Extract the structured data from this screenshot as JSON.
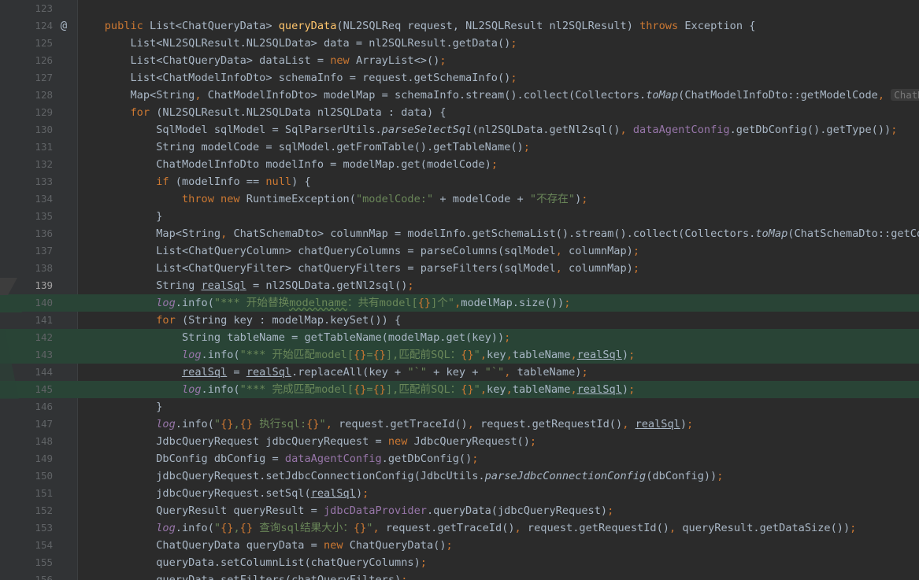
{
  "editor": {
    "language": "java",
    "current_line": "139",
    "colors": {
      "background": "#2b2b2b",
      "gutter": "#313335",
      "keyword": "#cc7832",
      "method": "#ffc66d",
      "string": "#6a8759",
      "field": "#9876aa",
      "diff_added": "#294436"
    },
    "gutter_icons": {
      "124": "override-at-icon"
    },
    "lines": [
      {
        "n": "123",
        "d": false,
        "t": []
      },
      {
        "n": "124",
        "d": false,
        "t": [
          [
            "    ",
            ""
          ],
          [
            "public ",
            "kw"
          ],
          [
            "List<ChatQueryData> ",
            ""
          ],
          [
            "queryData",
            "fn"
          ],
          [
            "(NL2SQLReq request, NL2SQLResult nl2SQLResult) ",
            ""
          ],
          [
            "throws ",
            "kw"
          ],
          [
            "Exception {",
            ""
          ]
        ]
      },
      {
        "n": "125",
        "d": false,
        "t": [
          [
            "        List<NL2SQLResult.NL2SQLData> data = nl2SQLResult.getData()",
            ""
          ],
          [
            ";",
            "kw"
          ]
        ]
      },
      {
        "n": "126",
        "d": false,
        "t": [
          [
            "        List<ChatQueryData> dataList = ",
            ""
          ],
          [
            "new ",
            "kw"
          ],
          [
            "ArrayList<>()",
            ""
          ],
          [
            ";",
            "kw"
          ]
        ]
      },
      {
        "n": "127",
        "d": false,
        "t": [
          [
            "        List<ChatModelInfoDto> schemaInfo = request.getSchemaInfo()",
            ""
          ],
          [
            ";",
            "kw"
          ]
        ]
      },
      {
        "n": "128",
        "d": false,
        "t": [
          [
            "        Map<String",
            ""
          ],
          [
            ", ",
            "kw"
          ],
          [
            "ChatModelInfoDto> modelMap = schemaInfo.stream().collect(Collectors.",
            ""
          ],
          [
            "toMap",
            "it"
          ],
          [
            "(ChatModelInfoDto::getModelCode",
            ""
          ],
          [
            ", ",
            "kw"
          ],
          [
            "ChatModelInfoDto",
            "hint"
          ]
        ]
      },
      {
        "n": "129",
        "d": false,
        "t": [
          [
            "        ",
            ""
          ],
          [
            "for ",
            "kw"
          ],
          [
            "(NL2SQLResult.NL2SQLData nl2SQLData : data) {",
            ""
          ]
        ]
      },
      {
        "n": "130",
        "d": false,
        "t": [
          [
            "            SqlModel sqlModel = SqlParserUtils.",
            ""
          ],
          [
            "parseSelectSql",
            "it"
          ],
          [
            "(nl2SQLData.getNl2sql()",
            ""
          ],
          [
            ", ",
            "kw"
          ],
          [
            "dataAgentConfig",
            "fd"
          ],
          [
            ".getDbConfig().getType())",
            ""
          ],
          [
            ";",
            "kw"
          ]
        ]
      },
      {
        "n": "131",
        "d": false,
        "t": [
          [
            "            String modelCode = sqlModel.getFromTable().getTableName()",
            ""
          ],
          [
            ";",
            "kw"
          ]
        ]
      },
      {
        "n": "132",
        "d": false,
        "t": [
          [
            "            ChatModelInfoDto modelInfo = modelMap.get(modelCode)",
            ""
          ],
          [
            ";",
            "kw"
          ]
        ]
      },
      {
        "n": "133",
        "d": false,
        "t": [
          [
            "            ",
            ""
          ],
          [
            "if ",
            "kw"
          ],
          [
            "(modelInfo == ",
            ""
          ],
          [
            "null",
            "kw"
          ],
          [
            ") {",
            ""
          ]
        ]
      },
      {
        "n": "134",
        "d": false,
        "t": [
          [
            "                ",
            ""
          ],
          [
            "throw new ",
            "kw"
          ],
          [
            "RuntimeException(",
            ""
          ],
          [
            "\"modelCode:\"",
            "st"
          ],
          [
            " + modelCode + ",
            ""
          ],
          [
            "\"不存在\"",
            "st"
          ],
          [
            ")",
            ""
          ],
          [
            ";",
            "kw"
          ]
        ]
      },
      {
        "n": "135",
        "d": false,
        "t": [
          [
            "            }",
            ""
          ]
        ]
      },
      {
        "n": "136",
        "d": false,
        "t": [
          [
            "            Map<String",
            ""
          ],
          [
            ", ",
            "kw"
          ],
          [
            "ChatSchemaDto> columnMap = modelInfo.getSchemaList().stream().collect(Collectors.",
            ""
          ],
          [
            "toMap",
            "it"
          ],
          [
            "(ChatSchemaDto::getColumnName",
            ""
          ]
        ]
      },
      {
        "n": "137",
        "d": false,
        "t": [
          [
            "            List<ChatQueryColumn> chatQueryColumns = parseColumns(sqlModel",
            ""
          ],
          [
            ", ",
            "kw"
          ],
          [
            "columnMap)",
            ""
          ],
          [
            ";",
            "kw"
          ]
        ]
      },
      {
        "n": "138",
        "d": false,
        "t": [
          [
            "            List<ChatQueryFilter> chatQueryFilters = parseFilters(sqlModel",
            ""
          ],
          [
            ", ",
            "kw"
          ],
          [
            "columnMap)",
            ""
          ],
          [
            ";",
            "kw"
          ]
        ]
      },
      {
        "n": "139",
        "d": false,
        "t": [
          [
            "            String ",
            ""
          ],
          [
            "realSql",
            "ul"
          ],
          [
            " = nl2SQLData.getNl2sql()",
            ""
          ],
          [
            ";",
            "kw"
          ]
        ]
      },
      {
        "n": "140",
        "d": true,
        "t": [
          [
            "            ",
            ""
          ],
          [
            "log",
            "fd it"
          ],
          [
            ".info(",
            ""
          ],
          [
            "\"*** 开始替换",
            "st"
          ],
          [
            "modelname",
            "st curly"
          ],
          [
            "：共有model[",
            "st"
          ],
          [
            "{}",
            "kw"
          ],
          [
            "]个\"",
            "st"
          ],
          [
            ",",
            "kw"
          ],
          [
            "modelMap.size())",
            ""
          ],
          [
            ";",
            "kw"
          ]
        ]
      },
      {
        "n": "141",
        "d": false,
        "t": [
          [
            "            ",
            ""
          ],
          [
            "for ",
            "kw"
          ],
          [
            "(String key : modelMap.keySet()) {",
            ""
          ]
        ]
      },
      {
        "n": "142",
        "d": true,
        "t": [
          [
            "                String tableName = getTableName(modelMap.get(key))",
            ""
          ],
          [
            ";",
            "kw"
          ]
        ]
      },
      {
        "n": "143",
        "d": true,
        "t": [
          [
            "                ",
            ""
          ],
          [
            "log",
            "fd it"
          ],
          [
            ".info(",
            ""
          ],
          [
            "\"*** 开始匹配model[",
            "st"
          ],
          [
            "{}",
            "kw"
          ],
          [
            "=",
            "st"
          ],
          [
            "{}",
            "kw"
          ],
          [
            "],匹配前SQL：",
            "st"
          ],
          [
            "{}",
            "kw"
          ],
          [
            "\"",
            "st"
          ],
          [
            ",",
            "kw"
          ],
          [
            "key",
            ""
          ],
          [
            ",",
            "kw"
          ],
          [
            "tableName",
            ""
          ],
          [
            ",",
            "kw"
          ],
          [
            "realSql",
            "ul"
          ],
          [
            ")",
            ""
          ],
          [
            ";",
            "kw"
          ]
        ]
      },
      {
        "n": "144",
        "d": false,
        "t": [
          [
            "                ",
            ""
          ],
          [
            "realSql",
            "ul"
          ],
          [
            " = ",
            ""
          ],
          [
            "realSql",
            "ul"
          ],
          [
            ".replaceAll(key + ",
            ""
          ],
          [
            "\"`\"",
            "st"
          ],
          [
            " + key + ",
            ""
          ],
          [
            "\"`\"",
            "st"
          ],
          [
            ", ",
            "kw"
          ],
          [
            "tableName)",
            ""
          ],
          [
            ";",
            "kw"
          ]
        ]
      },
      {
        "n": "145",
        "d": true,
        "t": [
          [
            "                ",
            ""
          ],
          [
            "log",
            "fd it"
          ],
          [
            ".info(",
            ""
          ],
          [
            "\"*** 完成匹配model[",
            "st"
          ],
          [
            "{}",
            "kw"
          ],
          [
            "=",
            "st"
          ],
          [
            "{}",
            "kw"
          ],
          [
            "],匹配前SQL：",
            "st"
          ],
          [
            "{}",
            "kw"
          ],
          [
            "\"",
            "st"
          ],
          [
            ",",
            "kw"
          ],
          [
            "key",
            ""
          ],
          [
            ",",
            "kw"
          ],
          [
            "tableName",
            ""
          ],
          [
            ",",
            "kw"
          ],
          [
            "realSql",
            "ul"
          ],
          [
            ")",
            ""
          ],
          [
            ";",
            "kw"
          ]
        ]
      },
      {
        "n": "146",
        "d": false,
        "t": [
          [
            "            }",
            ""
          ]
        ]
      },
      {
        "n": "147",
        "d": false,
        "t": [
          [
            "            ",
            ""
          ],
          [
            "log",
            "fd it"
          ],
          [
            ".info(",
            ""
          ],
          [
            "\"",
            "st"
          ],
          [
            "{}",
            "kw"
          ],
          [
            ",",
            "st"
          ],
          [
            "{}",
            "kw"
          ],
          [
            " 执行sql:",
            "st"
          ],
          [
            "{}",
            "kw"
          ],
          [
            "\"",
            "st"
          ],
          [
            ", ",
            "kw"
          ],
          [
            "request.getTraceId()",
            ""
          ],
          [
            ", ",
            "kw"
          ],
          [
            "request.getRequestId()",
            ""
          ],
          [
            ", ",
            "kw"
          ],
          [
            "realSql",
            "ul"
          ],
          [
            ")",
            ""
          ],
          [
            ";",
            "kw"
          ]
        ]
      },
      {
        "n": "148",
        "d": false,
        "t": [
          [
            "            JdbcQueryRequest jdbcQueryRequest = ",
            ""
          ],
          [
            "new ",
            "kw"
          ],
          [
            "JdbcQueryRequest()",
            ""
          ],
          [
            ";",
            "kw"
          ]
        ]
      },
      {
        "n": "149",
        "d": false,
        "t": [
          [
            "            DbConfig dbConfig = ",
            ""
          ],
          [
            "dataAgentConfig",
            "fd"
          ],
          [
            ".getDbConfig()",
            ""
          ],
          [
            ";",
            "kw"
          ]
        ]
      },
      {
        "n": "150",
        "d": false,
        "t": [
          [
            "            jdbcQueryRequest.setJdbcConnectionConfig(JdbcUtils.",
            ""
          ],
          [
            "parseJdbcConnectionConfig",
            "it"
          ],
          [
            "(dbConfig))",
            ""
          ],
          [
            ";",
            "kw"
          ]
        ]
      },
      {
        "n": "151",
        "d": false,
        "t": [
          [
            "            jdbcQueryRequest.setSql(",
            ""
          ],
          [
            "realSql",
            "ul"
          ],
          [
            ")",
            ""
          ],
          [
            ";",
            "kw"
          ]
        ]
      },
      {
        "n": "152",
        "d": false,
        "t": [
          [
            "            QueryResult queryResult = ",
            ""
          ],
          [
            "jdbcDataProvider",
            "fd"
          ],
          [
            ".queryData(jdbcQueryRequest)",
            ""
          ],
          [
            ";",
            "kw"
          ]
        ]
      },
      {
        "n": "153",
        "d": false,
        "t": [
          [
            "            ",
            ""
          ],
          [
            "log",
            "fd it"
          ],
          [
            ".info(",
            ""
          ],
          [
            "\"",
            "st"
          ],
          [
            "{}",
            "kw"
          ],
          [
            ",",
            "st"
          ],
          [
            "{}",
            "kw"
          ],
          [
            " 查询sql结果大小：",
            "st"
          ],
          [
            "{}",
            "kw"
          ],
          [
            "\"",
            "st"
          ],
          [
            ", ",
            "kw"
          ],
          [
            "request.getTraceId()",
            ""
          ],
          [
            ", ",
            "kw"
          ],
          [
            "request.getRequestId()",
            ""
          ],
          [
            ", ",
            "kw"
          ],
          [
            "queryResult.getDataSize())",
            ""
          ],
          [
            ";",
            "kw"
          ]
        ]
      },
      {
        "n": "154",
        "d": false,
        "t": [
          [
            "            ChatQueryData queryData = ",
            ""
          ],
          [
            "new ",
            "kw"
          ],
          [
            "ChatQueryData()",
            ""
          ],
          [
            ";",
            "kw"
          ]
        ]
      },
      {
        "n": "155",
        "d": false,
        "t": [
          [
            "            queryData.setColumnList(chatQueryColumns)",
            ""
          ],
          [
            ";",
            "kw"
          ]
        ]
      },
      {
        "n": "156",
        "d": false,
        "t": [
          [
            "            queryData.setFilters(chatQueryFilters)",
            ""
          ],
          [
            ";",
            "kw"
          ]
        ]
      }
    ]
  }
}
